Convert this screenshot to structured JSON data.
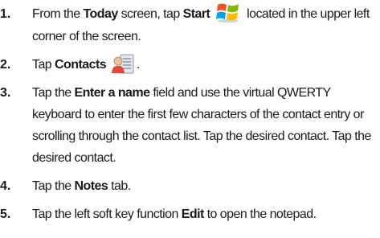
{
  "steps": [
    {
      "number": "1.",
      "t1": "From the ",
      "b1": "Today",
      "t2": " screen, tap ",
      "b2": "Start",
      "icon": "windows-start-icon",
      "t3": " located in the upper left corner of the screen."
    },
    {
      "number": "2.",
      "t1": "Tap ",
      "b1": "Contacts",
      "icon": "contacts-icon",
      "t2": "."
    },
    {
      "number": "3.",
      "t1": "Tap the ",
      "b1": "Enter a name",
      "t2": " field and use the virtual QWERTY keyboard to enter the first few characters of the contact entry or scrolling through the contact list. Tap the desired contact. Tap the desired contact."
    },
    {
      "number": "4.",
      "t1": "Tap the ",
      "b1": "Notes",
      "t2": " tab."
    },
    {
      "number": "5.",
      "t1": "Tap the left soft key function ",
      "b1": "Edit",
      "t2": " to open the notepad."
    }
  ]
}
